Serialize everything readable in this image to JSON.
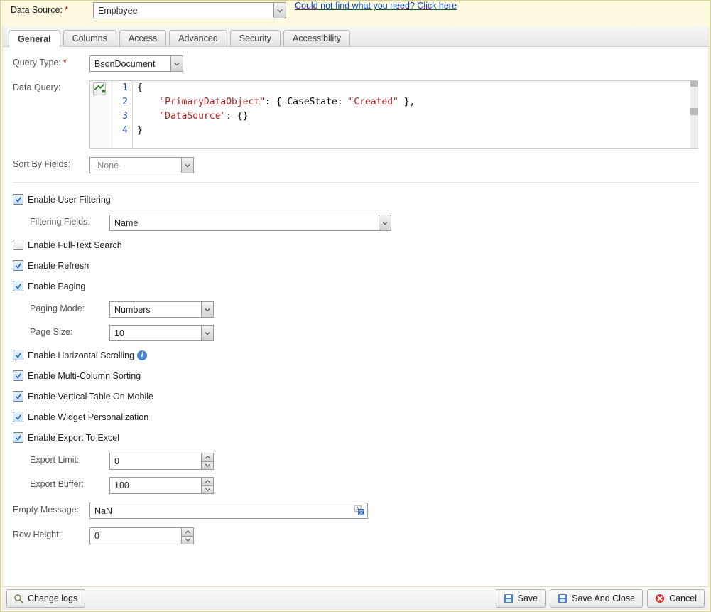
{
  "header": {
    "data_source_label": "Data Source:",
    "data_source_value": "Employee",
    "help_link": "Could not find what you need? Click here"
  },
  "tabs": [
    "General",
    "Columns",
    "Access",
    "Advanced",
    "Security",
    "Accessibility"
  ],
  "active_tab": 0,
  "general": {
    "query_type_label": "Query Type:",
    "query_type_value": "BsonDocument",
    "data_query_label": "Data Query:",
    "code_lines": [
      {
        "n": "1",
        "raw": "{"
      },
      {
        "n": "2",
        "raw": "    \"PrimaryDataObject\": { CaseState: \"Created\" },",
        "key": "\"PrimaryDataObject\"",
        "mid": ": { CaseState: ",
        "val": "\"Created\"",
        "tail": " },"
      },
      {
        "n": "3",
        "raw": "    \"DataSource\": {}",
        "key": "\"DataSource\"",
        "mid": ": {}"
      },
      {
        "n": "4",
        "raw": "}"
      }
    ],
    "sort_by_label": "Sort By Fields:",
    "sort_by_value": "-None-",
    "enable_user_filtering": "Enable User Filtering",
    "filtering_fields_label": "Filtering Fields:",
    "filtering_fields_value": "Name",
    "enable_full_text": "Enable Full-Text Search",
    "enable_refresh": "Enable Refresh",
    "enable_paging": "Enable Paging",
    "paging_mode_label": "Paging Mode:",
    "paging_mode_value": "Numbers",
    "page_size_label": "Page Size:",
    "page_size_value": "10",
    "enable_horizontal_scrolling": "Enable Horizontal Scrolling",
    "enable_multi_sort": "Enable Multi-Column Sorting",
    "enable_vertical_mobile": "Enable Vertical Table On Mobile",
    "enable_personalization": "Enable Widget Personalization",
    "enable_export": "Enable Export To Excel",
    "export_limit_label": "Export Limit:",
    "export_limit_value": "0",
    "export_buffer_label": "Export Buffer:",
    "export_buffer_value": "100",
    "empty_message_label": "Empty Message:",
    "empty_message_value": "NaN",
    "row_height_label": "Row Height:",
    "row_height_value": "0"
  },
  "footer": {
    "change_logs": "Change logs",
    "save": "Save",
    "save_close": "Save And Close",
    "cancel": "Cancel"
  }
}
